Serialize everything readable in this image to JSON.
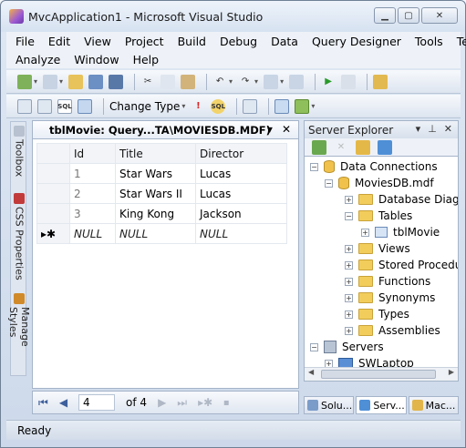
{
  "window": {
    "title": "MvcApplication1 - Microsoft Visual Studio"
  },
  "menu": {
    "row1": [
      "File",
      "Edit",
      "View",
      "Project",
      "Build",
      "Debug",
      "Data",
      "Query Designer",
      "Tools",
      "Test"
    ],
    "row2": [
      "Analyze",
      "Window",
      "Help"
    ]
  },
  "toolbar2": {
    "change_type_label": "Change Type"
  },
  "side_tabs": [
    "Toolbox",
    "CSS Properties",
    "Manage Styles"
  ],
  "document": {
    "tab_label": "tblMovie: Query...TA\\MOVIESDB.MDF)",
    "columns": [
      "Id",
      "Title",
      "Director"
    ],
    "rows": [
      {
        "marker": "",
        "id": "1",
        "title": "Star Wars",
        "director": "Lucas"
      },
      {
        "marker": "",
        "id": "2",
        "title": "Star Wars II",
        "director": "Lucas"
      },
      {
        "marker": "",
        "id": "3",
        "title": "King Kong",
        "director": "Jackson"
      },
      {
        "marker": "▸✱",
        "id": "NULL",
        "title": "NULL",
        "director": "NULL"
      }
    ],
    "navigator": {
      "current_row": "4",
      "of_label": "of 4"
    }
  },
  "server_explorer": {
    "title": "Server Explorer",
    "nodes": [
      {
        "label": "Data Connections",
        "expander": "−"
      },
      {
        "label": "MoviesDB.mdf",
        "expander": "−"
      },
      {
        "label": "Database Diagr",
        "expander": "+"
      },
      {
        "label": "Tables",
        "expander": "−"
      },
      {
        "label": "tblMovie",
        "expander": "+"
      },
      {
        "label": "Views",
        "expander": "+"
      },
      {
        "label": "Stored Procedu",
        "expander": "+"
      },
      {
        "label": "Functions",
        "expander": "+"
      },
      {
        "label": "Synonyms",
        "expander": "+"
      },
      {
        "label": "Types",
        "expander": "+"
      },
      {
        "label": "Assemblies",
        "expander": "+"
      },
      {
        "label": "Servers",
        "expander": "−"
      },
      {
        "label": "SWLaptop",
        "expander": "+"
      }
    ],
    "bottom_tabs": [
      "Solu...",
      "Serv...",
      "Mac..."
    ]
  },
  "status": {
    "text": "Ready"
  },
  "colors": {
    "chrome": "#dfe8f4",
    "accent": "#3d5f9b",
    "folder": "#f2cd5c"
  }
}
